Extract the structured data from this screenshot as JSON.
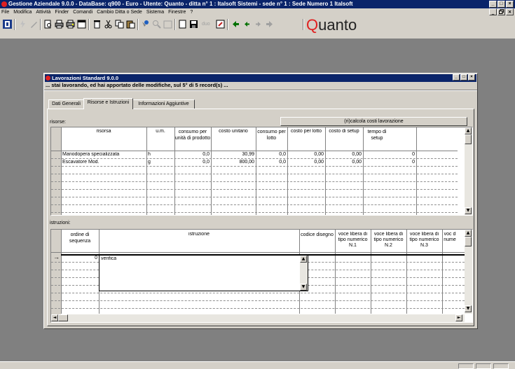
{
  "app": {
    "title": "Gestione Aziendale 9.0.0 - DataBase: q900 - Euro - Utente: Quanto - ditta n° 1 : Italsoft Sistemi - sede n° 1 : Sede Numero 1 Italsoft",
    "window_buttons": [
      "_",
      "□",
      "×"
    ],
    "mdi_buttons": [
      "_",
      "³",
      "×"
    ],
    "brand": {
      "first": "Q",
      "rest": "uanto"
    }
  },
  "menu": [
    "File",
    "Modifica",
    "Attività",
    "Finder",
    "Comandi",
    "Cambio Ditta o Sede",
    "Sistema",
    "Finestre",
    "?"
  ],
  "toolbar_icons": [
    "exit-icon",
    "lightning-icon",
    "pen-icon",
    "print-preview-icon",
    "print-icon",
    "print-setup-icon",
    "copy-window-icon",
    "delete-icon",
    "cut-icon",
    "copy-icon",
    "paste-icon",
    "find-icon",
    "zoom-icon",
    "calendar-icon",
    "new-record-icon",
    "save-icon",
    "duo-icon",
    "edit-icon",
    "first-record-icon",
    "previous-record-icon",
    "next-record-icon",
    "last-record-icon"
  ],
  "toolbar_duo_label": "duo",
  "child": {
    "title": "Lavorazioni Standard 9.0.0",
    "status": "... stai lavorando, ed hai apportato delle modifiche, sul 5° di 5 record(s) ...",
    "window_buttons": [
      "_",
      "□",
      "×"
    ]
  },
  "tabs": [
    "Dati Generali",
    "Risorse e Istruzioni",
    "Informazioni Aggiuntive"
  ],
  "active_tab": 1,
  "risorse": {
    "label": "risorse:",
    "recalc_button": "(ri)calcola costi lavorazione",
    "headers": [
      "risorsa",
      "u.m.",
      "consumo per unità di prodotto",
      "costo unitario",
      "consumo per lotto",
      "costo per lotto",
      "costo di setup",
      "tempo di setup"
    ],
    "rows": [
      [
        "Manodopera specializzata",
        "h",
        "0,0",
        "30,99",
        "0,0",
        "0,00",
        "0,00",
        "0"
      ],
      [
        "Escavatore Mod.",
        "g",
        "0,0",
        "800,00",
        "0,0",
        "0,00",
        "0,00",
        "0"
      ]
    ]
  },
  "istruzioni": {
    "label": "istruzioni:",
    "headers": [
      "ordine di sequenza",
      "istruzione",
      "codice disegno",
      "voce libera di tipo numerico N.1",
      "voce libera di tipo numerico N.2",
      "voce libera di tipo numerico N.3",
      "voc d nume"
    ],
    "rows": [
      [
        "0",
        "verifica",
        "",
        "",
        "",
        "",
        ""
      ]
    ],
    "row_pointer": "→"
  },
  "scroll_arrows": {
    "up": "▲",
    "down": "▼",
    "left": "◄",
    "right": "►"
  }
}
